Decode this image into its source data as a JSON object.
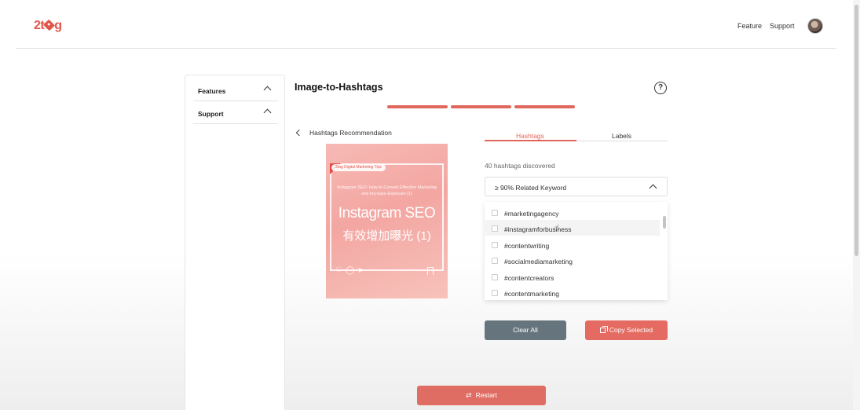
{
  "header": {
    "logo": "2tag",
    "nav": [
      "Feature",
      "Support"
    ]
  },
  "sidebar": {
    "items": [
      {
        "label": "Features"
      },
      {
        "label": "Support"
      }
    ]
  },
  "main": {
    "title": "Image-to-Hashtags",
    "help_icon": "?",
    "steps_completed": 3,
    "back_label": "Hashtags Recommendation",
    "image": {
      "badge": "2tag Digital Marketing Tips",
      "subtitle": "Instagram SEO: How to Convert Effective Marketing and Increase Exposure (1)",
      "title": "Instagram SEO",
      "title_cn": "有效增加曝光 (1)"
    },
    "tabs": [
      {
        "label": "Hashtags",
        "active": true
      },
      {
        "label": "Labels",
        "active": false
      }
    ],
    "count_text": "40 hashtags discovered",
    "filter": {
      "selected": "≥ 90% Related Keyword"
    },
    "hashtags": [
      "#marketingagency",
      "#instagramforbusiness",
      "#contentwriting",
      "#socialmediamarketing",
      "#contentcreators",
      "#contentmarketing"
    ],
    "buttons": {
      "clear_all": "Clear All",
      "copy_selected": "Copy Selected",
      "restart": "Restart"
    }
  },
  "colors": {
    "accent": "#e0675c",
    "clear_button": "#66757d",
    "copy_button": "#e56a61"
  }
}
